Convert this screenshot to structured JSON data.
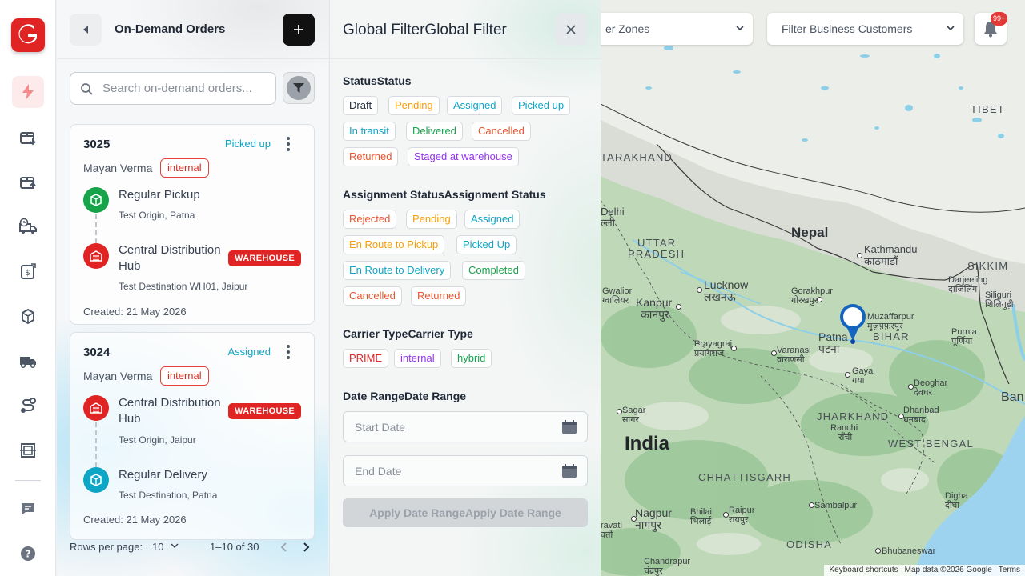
{
  "app": {
    "name": "On-Demand Orders"
  },
  "colors": {
    "brand": "#e02424",
    "accent_blue": "#0ea5c6",
    "text": "#1f2937"
  },
  "rail": {
    "items": [
      {
        "icon": "lightning-icon",
        "active": true
      },
      {
        "icon": "box-download-icon"
      },
      {
        "icon": "box-upload-icon"
      },
      {
        "icon": "truck-clock-icon"
      },
      {
        "icon": "billing-icon"
      },
      {
        "icon": "boxes-icon"
      },
      {
        "icon": "delivery-truck-icon"
      },
      {
        "icon": "route-icon"
      },
      {
        "icon": "scan-frame-icon"
      },
      {
        "icon": "chat-icon"
      },
      {
        "icon": "help-icon"
      }
    ]
  },
  "orders": {
    "title": "On-Demand Orders",
    "search_placeholder": "Search on-demand orders...",
    "list": [
      {
        "id": "3025",
        "status": "Picked up",
        "customer": "Mayan Verma",
        "tag": "internal",
        "origin": {
          "title": "Regular Pickup",
          "subtitle": "Test Origin, Patna"
        },
        "destination": {
          "title_line1": "Central Distribution",
          "title_line2": "Hub",
          "badge": "WAREHOUSE",
          "subtitle": "Test Destination WH01, Jaipur"
        },
        "created": "Created: 21 May 2026"
      },
      {
        "id": "3024",
        "status": "Assigned",
        "customer": "Mayan Verma",
        "tag": "internal",
        "origin": {
          "title_line1": "Central Distribution",
          "title_line2": "Hub",
          "badge": "WAREHOUSE",
          "subtitle": "Test Origin, Jaipur"
        },
        "destination": {
          "title": "Regular Delivery",
          "subtitle": "Test Destination, Patna"
        },
        "created": "Created: 21 May 2026"
      }
    ],
    "pagination": {
      "rows_label": "Rows per page:",
      "rows_value": "10",
      "range": "1–10 of 30"
    }
  },
  "filter": {
    "title": "Global FilterGlobal Filter",
    "sections": {
      "status": {
        "title": "StatusStatus",
        "chips": [
          "Draft",
          "Pending",
          "Assigned",
          "Picked up",
          "In transit",
          "Delivered",
          "Cancelled",
          "Returned",
          "Staged at warehouse"
        ]
      },
      "assignment": {
        "title": "Assignment StatusAssignment Status",
        "chips": [
          "Rejected",
          "Pending",
          "Assigned",
          "En Route to Pickup",
          "Picked Up",
          "En Route to Delivery",
          "Completed",
          "Cancelled",
          "Returned"
        ]
      },
      "carrier": {
        "title": "Carrier TypeCarrier Type",
        "chips": [
          "PRIME",
          "internal",
          "hybrid"
        ]
      },
      "date": {
        "title": "Date RangeDate Range",
        "start_placeholder": "Start Date",
        "end_placeholder": "End Date",
        "apply_label": "Apply Date RangeApply Date Range"
      }
    }
  },
  "map": {
    "zone_select": "er Zones",
    "customer_select": "Filter Business Customers",
    "notifications_badge": "99+",
    "labels": {
      "tibet": "TIBET",
      "uttarakhand": "TARAKHAND",
      "delhi_1": "Delhi",
      "delhi_2": "ल्ली",
      "nepal": "Nepal",
      "kathmandu_en": "Kathmandu",
      "kathmandu_hi": "काठमाडौं",
      "sikkim": "SIKKIM",
      "uttar_pradesh_1": "UTTAR",
      "uttar_pradesh_2": "PRADESH",
      "lucknow_en": "Lucknow",
      "lucknow_hi": "लखनऊ",
      "gorakhpur_en": "Gorakhpur",
      "gorakhpur_hi": "गोरखपुर",
      "darjeeling_en": "Darjeeling",
      "darjeeling_hi": "दार्जिलिंग",
      "siliguri_en": "Siliguri",
      "siliguri_hi": "शिलिगुड़ी",
      "gwalior_en": "Gwalior",
      "gwalior_hi": "ग्वालियर",
      "kanpur_en": "Kanpur",
      "kanpur_hi": "कानपुर",
      "muzaffarpur_en": "Muzaffarpur",
      "muzaffarpur_hi": "मुज़फ़्फ़रपुर",
      "patna_en": "Patna",
      "patna_hi": "पटना",
      "bihar": "BIHAR",
      "purnia_en": "Purnia",
      "purnia_hi": "पूर्णिया",
      "prayagraj_en": "Prayagraj",
      "prayagraj_hi": "प्रयागराज",
      "varanasi_en": "Varanasi",
      "varanasi_hi": "वाराणसी",
      "gaya_en": "Gaya",
      "gaya_hi": "गया",
      "deoghar_en": "Deoghar",
      "deoghar_hi": "देवघर",
      "ban": "Ban",
      "sagar_en": "Sagar",
      "sagar_hi": "सागर",
      "jharkhand": "JHARKHAND",
      "dhanbad_en": "Dhanbad",
      "dhanbad_hi": "धनबाद",
      "ranchi_en": "Ranchi",
      "ranchi_hi": "राँची",
      "india": "India",
      "west_bengal": "WEST BENGAL",
      "chhattisgarh": "CHHATTISGARH",
      "nagpur_en": "Nagpur",
      "nagpur_hi": "नागपुर",
      "bhilai_en": "Bhilai",
      "bhilai_hi": "भिलाई",
      "raipur_en": "Raipur",
      "raipur_hi": "रायपुर",
      "sambalpur": "Sambalpur",
      "digha_en": "Digha",
      "digha_hi": "दीघा",
      "ravati_1": "ravati",
      "ravati_2": "वती",
      "odisha": "ODISHA",
      "bhubaneswar": "Bhubaneswar",
      "chandrapur_en": "Chandrapur",
      "chandrapur_hi": "चंद्रपुर"
    },
    "attribution": [
      "Keyboard shortcuts",
      "Map data ©2026 Google",
      "Terms"
    ]
  }
}
